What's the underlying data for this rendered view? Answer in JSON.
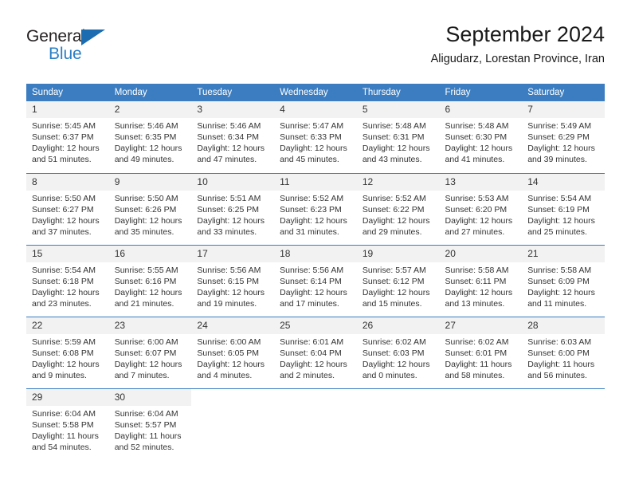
{
  "logo": {
    "word_top": "General",
    "word_bottom": "Blue",
    "triangle_color": "#1b6cb0",
    "text_color_top": "#231f20",
    "text_color_bottom": "#2b7fc4"
  },
  "header": {
    "title": "September 2024",
    "subtitle": "Aligudarz, Lorestan Province, Iran"
  },
  "theme": {
    "header_bg": "#3b7dc0",
    "header_text": "#ffffff",
    "daynum_bg": "#f2f2f2",
    "body_text": "#333333"
  },
  "weekday_headers": [
    "Sunday",
    "Monday",
    "Tuesday",
    "Wednesday",
    "Thursday",
    "Friday",
    "Saturday"
  ],
  "labels": {
    "sunrise_prefix": "Sunrise:",
    "sunset_prefix": "Sunset:",
    "daylight_prefix": "Daylight:"
  },
  "weeks": [
    [
      {
        "day": "1",
        "sunrise": "Sunrise: 5:45 AM",
        "sunset": "Sunset: 6:37 PM",
        "daylight_1": "Daylight: 12 hours",
        "daylight_2": "and 51 minutes."
      },
      {
        "day": "2",
        "sunrise": "Sunrise: 5:46 AM",
        "sunset": "Sunset: 6:35 PM",
        "daylight_1": "Daylight: 12 hours",
        "daylight_2": "and 49 minutes."
      },
      {
        "day": "3",
        "sunrise": "Sunrise: 5:46 AM",
        "sunset": "Sunset: 6:34 PM",
        "daylight_1": "Daylight: 12 hours",
        "daylight_2": "and 47 minutes."
      },
      {
        "day": "4",
        "sunrise": "Sunrise: 5:47 AM",
        "sunset": "Sunset: 6:33 PM",
        "daylight_1": "Daylight: 12 hours",
        "daylight_2": "and 45 minutes."
      },
      {
        "day": "5",
        "sunrise": "Sunrise: 5:48 AM",
        "sunset": "Sunset: 6:31 PM",
        "daylight_1": "Daylight: 12 hours",
        "daylight_2": "and 43 minutes."
      },
      {
        "day": "6",
        "sunrise": "Sunrise: 5:48 AM",
        "sunset": "Sunset: 6:30 PM",
        "daylight_1": "Daylight: 12 hours",
        "daylight_2": "and 41 minutes."
      },
      {
        "day": "7",
        "sunrise": "Sunrise: 5:49 AM",
        "sunset": "Sunset: 6:29 PM",
        "daylight_1": "Daylight: 12 hours",
        "daylight_2": "and 39 minutes."
      }
    ],
    [
      {
        "day": "8",
        "sunrise": "Sunrise: 5:50 AM",
        "sunset": "Sunset: 6:27 PM",
        "daylight_1": "Daylight: 12 hours",
        "daylight_2": "and 37 minutes."
      },
      {
        "day": "9",
        "sunrise": "Sunrise: 5:50 AM",
        "sunset": "Sunset: 6:26 PM",
        "daylight_1": "Daylight: 12 hours",
        "daylight_2": "and 35 minutes."
      },
      {
        "day": "10",
        "sunrise": "Sunrise: 5:51 AM",
        "sunset": "Sunset: 6:25 PM",
        "daylight_1": "Daylight: 12 hours",
        "daylight_2": "and 33 minutes."
      },
      {
        "day": "11",
        "sunrise": "Sunrise: 5:52 AM",
        "sunset": "Sunset: 6:23 PM",
        "daylight_1": "Daylight: 12 hours",
        "daylight_2": "and 31 minutes."
      },
      {
        "day": "12",
        "sunrise": "Sunrise: 5:52 AM",
        "sunset": "Sunset: 6:22 PM",
        "daylight_1": "Daylight: 12 hours",
        "daylight_2": "and 29 minutes."
      },
      {
        "day": "13",
        "sunrise": "Sunrise: 5:53 AM",
        "sunset": "Sunset: 6:20 PM",
        "daylight_1": "Daylight: 12 hours",
        "daylight_2": "and 27 minutes."
      },
      {
        "day": "14",
        "sunrise": "Sunrise: 5:54 AM",
        "sunset": "Sunset: 6:19 PM",
        "daylight_1": "Daylight: 12 hours",
        "daylight_2": "and 25 minutes."
      }
    ],
    [
      {
        "day": "15",
        "sunrise": "Sunrise: 5:54 AM",
        "sunset": "Sunset: 6:18 PM",
        "daylight_1": "Daylight: 12 hours",
        "daylight_2": "and 23 minutes."
      },
      {
        "day": "16",
        "sunrise": "Sunrise: 5:55 AM",
        "sunset": "Sunset: 6:16 PM",
        "daylight_1": "Daylight: 12 hours",
        "daylight_2": "and 21 minutes."
      },
      {
        "day": "17",
        "sunrise": "Sunrise: 5:56 AM",
        "sunset": "Sunset: 6:15 PM",
        "daylight_1": "Daylight: 12 hours",
        "daylight_2": "and 19 minutes."
      },
      {
        "day": "18",
        "sunrise": "Sunrise: 5:56 AM",
        "sunset": "Sunset: 6:14 PM",
        "daylight_1": "Daylight: 12 hours",
        "daylight_2": "and 17 minutes."
      },
      {
        "day": "19",
        "sunrise": "Sunrise: 5:57 AM",
        "sunset": "Sunset: 6:12 PM",
        "daylight_1": "Daylight: 12 hours",
        "daylight_2": "and 15 minutes."
      },
      {
        "day": "20",
        "sunrise": "Sunrise: 5:58 AM",
        "sunset": "Sunset: 6:11 PM",
        "daylight_1": "Daylight: 12 hours",
        "daylight_2": "and 13 minutes."
      },
      {
        "day": "21",
        "sunrise": "Sunrise: 5:58 AM",
        "sunset": "Sunset: 6:09 PM",
        "daylight_1": "Daylight: 12 hours",
        "daylight_2": "and 11 minutes."
      }
    ],
    [
      {
        "day": "22",
        "sunrise": "Sunrise: 5:59 AM",
        "sunset": "Sunset: 6:08 PM",
        "daylight_1": "Daylight: 12 hours",
        "daylight_2": "and 9 minutes."
      },
      {
        "day": "23",
        "sunrise": "Sunrise: 6:00 AM",
        "sunset": "Sunset: 6:07 PM",
        "daylight_1": "Daylight: 12 hours",
        "daylight_2": "and 7 minutes."
      },
      {
        "day": "24",
        "sunrise": "Sunrise: 6:00 AM",
        "sunset": "Sunset: 6:05 PM",
        "daylight_1": "Daylight: 12 hours",
        "daylight_2": "and 4 minutes."
      },
      {
        "day": "25",
        "sunrise": "Sunrise: 6:01 AM",
        "sunset": "Sunset: 6:04 PM",
        "daylight_1": "Daylight: 12 hours",
        "daylight_2": "and 2 minutes."
      },
      {
        "day": "26",
        "sunrise": "Sunrise: 6:02 AM",
        "sunset": "Sunset: 6:03 PM",
        "daylight_1": "Daylight: 12 hours",
        "daylight_2": "and 0 minutes."
      },
      {
        "day": "27",
        "sunrise": "Sunrise: 6:02 AM",
        "sunset": "Sunset: 6:01 PM",
        "daylight_1": "Daylight: 11 hours",
        "daylight_2": "and 58 minutes."
      },
      {
        "day": "28",
        "sunrise": "Sunrise: 6:03 AM",
        "sunset": "Sunset: 6:00 PM",
        "daylight_1": "Daylight: 11 hours",
        "daylight_2": "and 56 minutes."
      }
    ],
    [
      {
        "day": "29",
        "sunrise": "Sunrise: 6:04 AM",
        "sunset": "Sunset: 5:58 PM",
        "daylight_1": "Daylight: 11 hours",
        "daylight_2": "and 54 minutes."
      },
      {
        "day": "30",
        "sunrise": "Sunrise: 6:04 AM",
        "sunset": "Sunset: 5:57 PM",
        "daylight_1": "Daylight: 11 hours",
        "daylight_2": "and 52 minutes."
      },
      {
        "day": "",
        "sunrise": "",
        "sunset": "",
        "daylight_1": "",
        "daylight_2": ""
      },
      {
        "day": "",
        "sunrise": "",
        "sunset": "",
        "daylight_1": "",
        "daylight_2": ""
      },
      {
        "day": "",
        "sunrise": "",
        "sunset": "",
        "daylight_1": "",
        "daylight_2": ""
      },
      {
        "day": "",
        "sunrise": "",
        "sunset": "",
        "daylight_1": "",
        "daylight_2": ""
      },
      {
        "day": "",
        "sunrise": "",
        "sunset": "",
        "daylight_1": "",
        "daylight_2": ""
      }
    ]
  ]
}
